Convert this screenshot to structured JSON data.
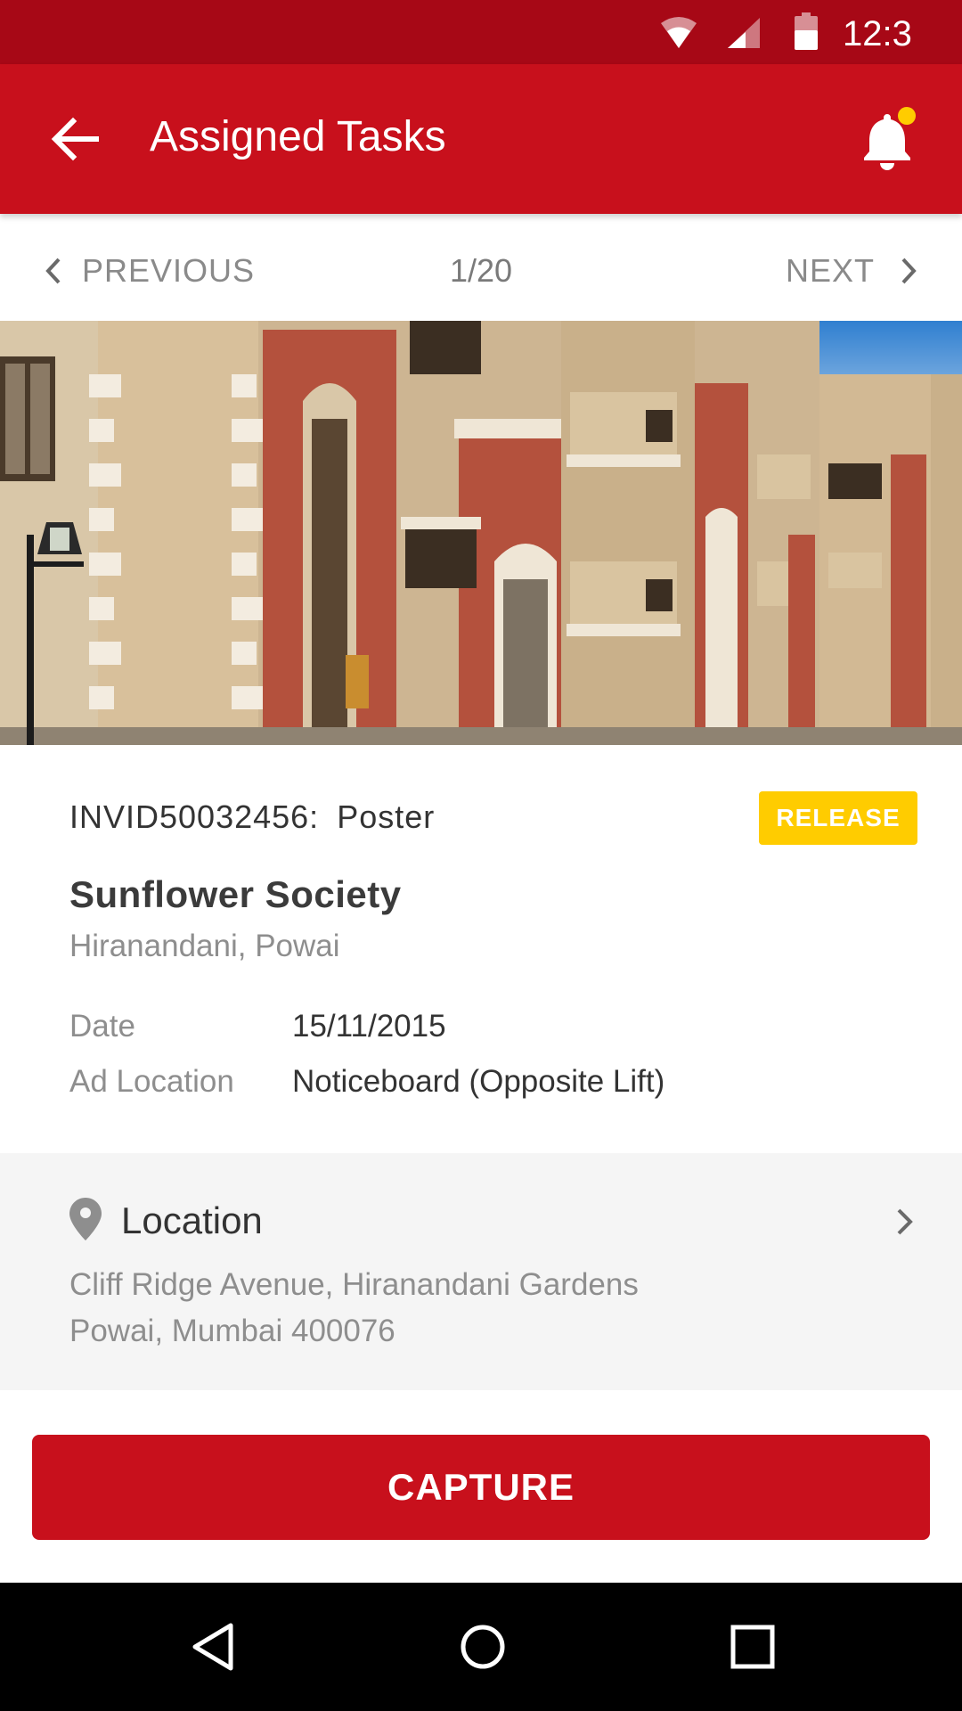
{
  "status_bar": {
    "time": "12:3",
    "icons": [
      "wifi-icon",
      "cellular-signal-icon",
      "battery-icon"
    ]
  },
  "app_bar": {
    "title": "Assigned Tasks",
    "back_icon": "arrow-left-icon",
    "notification_icon": "bell-icon",
    "notification_dot_color": "#ffcc00"
  },
  "pager": {
    "previous_label": "PREVIOUS",
    "count": "1/20",
    "next_label": "NEXT"
  },
  "task": {
    "invoice_id": "INVID50032456:",
    "ad_type": "Poster",
    "status_badge": "RELEASE",
    "society_name": "Sunflower Society",
    "area": "Hiranandani, Powai",
    "fields": {
      "date_label": "Date",
      "date_value": "15/11/2015",
      "ad_location_label": "Ad Location",
      "ad_location_value": "Noticeboard (Opposite Lift)"
    }
  },
  "location": {
    "heading": "Location",
    "address_line1": "Cliff Ridge Avenue, Hiranandani Gardens",
    "address_line2": "Powai, Mumbai 400076"
  },
  "actions": {
    "capture_label": "CAPTURE"
  },
  "colors": {
    "status_bar": "#a70816",
    "primary": "#c8101c",
    "badge": "#ffcc00",
    "section_bg": "#f5f5f5"
  }
}
